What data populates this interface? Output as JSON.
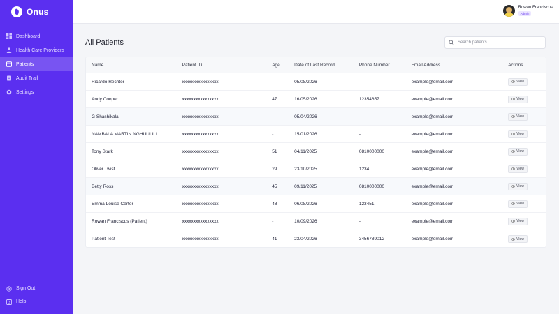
{
  "app": {
    "name": "Onus"
  },
  "sidebar": {
    "items": [
      {
        "label": "Dashboard",
        "icon": "dashboard-icon",
        "active": false
      },
      {
        "label": "Health Care Providers",
        "icon": "providers-icon",
        "active": false
      },
      {
        "label": "Patients",
        "icon": "patients-icon",
        "active": true
      },
      {
        "label": "Audit Trail",
        "icon": "audit-icon",
        "active": false
      },
      {
        "label": "Settings",
        "icon": "settings-icon",
        "active": false
      }
    ],
    "bottom": [
      {
        "label": "Sign Out",
        "icon": "sign-out-icon"
      },
      {
        "label": "Help",
        "icon": "help-icon"
      }
    ]
  },
  "header": {
    "user_name": "Rowan Franciscus",
    "user_role": "Admin"
  },
  "page": {
    "title": "All Patients",
    "search_placeholder": "Search patients..."
  },
  "table": {
    "columns": [
      "Name",
      "Patient ID",
      "Age",
      "Date of Last Record",
      "Phone Number",
      "Email Address",
      "Actions"
    ],
    "action_label": "View",
    "rows": [
      {
        "name": "Ricardo Rechter",
        "id": "xxxxxxxxxxxxxxxx",
        "age": "-",
        "date": "05/08/2026",
        "phone": "-",
        "email": "example@email.com"
      },
      {
        "name": "Andy Cooper",
        "id": "xxxxxxxxxxxxxxxx",
        "age": "47",
        "date": "16/05/2026",
        "phone": "12354657",
        "email": "example@email.com"
      },
      {
        "name": "G Shashikala",
        "id": "xxxxxxxxxxxxxxxx",
        "age": "-",
        "date": "05/04/2026",
        "phone": "-",
        "email": "example@email.com"
      },
      {
        "name": "NAMBALA MARTIN NGHUULILI",
        "id": "xxxxxxxxxxxxxxxx",
        "age": "-",
        "date": "15/01/2026",
        "phone": "-",
        "email": "example@email.com"
      },
      {
        "name": "Tony Stark",
        "id": "xxxxxxxxxxxxxxxx",
        "age": "51",
        "date": "04/11/2025",
        "phone": "0810000000",
        "email": "example@email.com"
      },
      {
        "name": "Oliver Twist",
        "id": "xxxxxxxxxxxxxxxx",
        "age": "29",
        "date": "23/10/2025",
        "phone": "1234",
        "email": "example@email.com"
      },
      {
        "name": "Betty Ross",
        "id": "xxxxxxxxxxxxxxxx",
        "age": "45",
        "date": "09/11/2025",
        "phone": "0810000000",
        "email": "example@email.com"
      },
      {
        "name": "Emma Louise Carter",
        "id": "xxxxxxxxxxxxxxxx",
        "age": "48",
        "date": "06/08/2026",
        "phone": "123451",
        "email": "example@email.com"
      },
      {
        "name": "Rowan Franciscus (Patient)",
        "id": "xxxxxxxxxxxxxxxx",
        "age": "-",
        "date": "10/09/2026",
        "phone": "-",
        "email": "example@email.com"
      },
      {
        "name": "Patient Test",
        "id": "xxxxxxxxxxxxxxxx",
        "age": "41",
        "date": "23/04/2026",
        "phone": "3456789012",
        "email": "example@email.com"
      }
    ]
  },
  "colors": {
    "sidebar": "#5b2ff0",
    "accent": "#6a3ff0",
    "background": "#f4f5f8"
  }
}
